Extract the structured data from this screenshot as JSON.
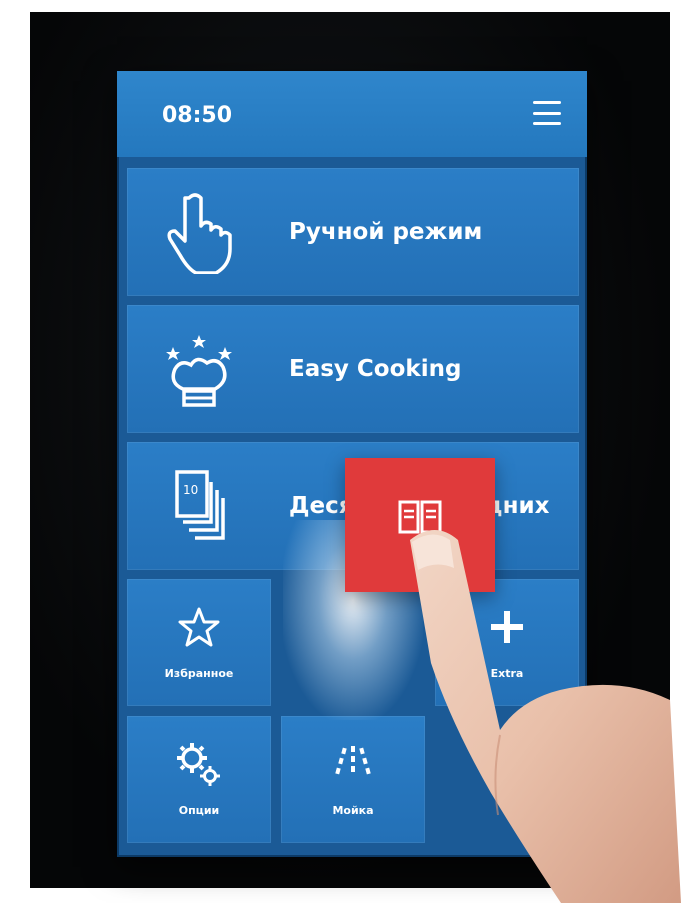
{
  "status": {
    "time": "08:50"
  },
  "menu": {
    "icon": "hamburger-menu-icon"
  },
  "tiles": [
    {
      "label": "Ручной режим",
      "icon": "hand-pointer-icon"
    },
    {
      "label": "Easy Cooking",
      "icon": "chef-hat-stars-icon"
    },
    {
      "label": "Десяток последних",
      "icon": "stacked-cards-10-icon"
    }
  ],
  "small_tiles": [
    {
      "label": "Избранное",
      "icon": "star-outline-icon"
    },
    {
      "label": "Extra",
      "icon": "plus-icon"
    },
    {
      "label": "Опции",
      "icon": "gears-icon"
    },
    {
      "label": "Мойка",
      "icon": "wash-spray-icon"
    }
  ],
  "dragged_tile": {
    "icon": "open-book-icon",
    "color": "#e03a3b"
  },
  "colors": {
    "screen": "#2478be",
    "accent_red": "#e03a3b",
    "text": "#ffffff"
  }
}
